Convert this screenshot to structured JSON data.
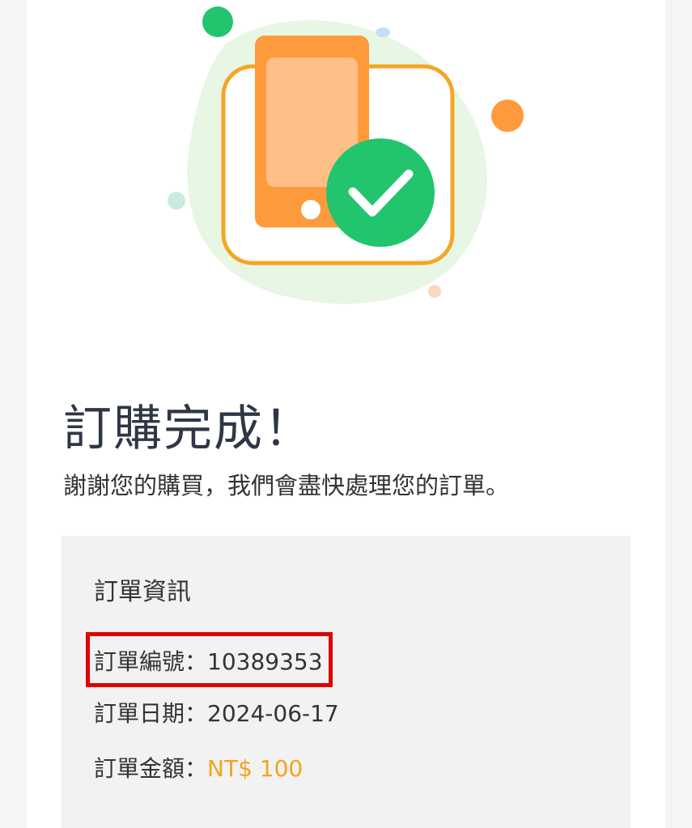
{
  "header": {
    "title": "訂購完成！",
    "subtitle": "謝謝您的購買，我們會盡快處理您的訂單。"
  },
  "illustration": {
    "icon": "phone-with-check-icon",
    "colors": {
      "blob": "#e8f6e4",
      "frame": "#f5a623",
      "phone": "#ff9a3c",
      "screen": "#ffbf86",
      "check": "#22c46e"
    }
  },
  "order_info": {
    "heading": "訂單資訊",
    "number_label": "訂單編號：",
    "number_value": "10389353",
    "date_label": "訂單日期：",
    "date_value": "2024-06-17",
    "amount_label": "訂單金額：",
    "amount_value": "NT$ 100"
  },
  "colors": {
    "title_text": "#2f3646",
    "body_text": "#333333",
    "amount_text": "#f4a31c",
    "info_background": "#f2f2f2",
    "highlight_border": "#e00000"
  }
}
